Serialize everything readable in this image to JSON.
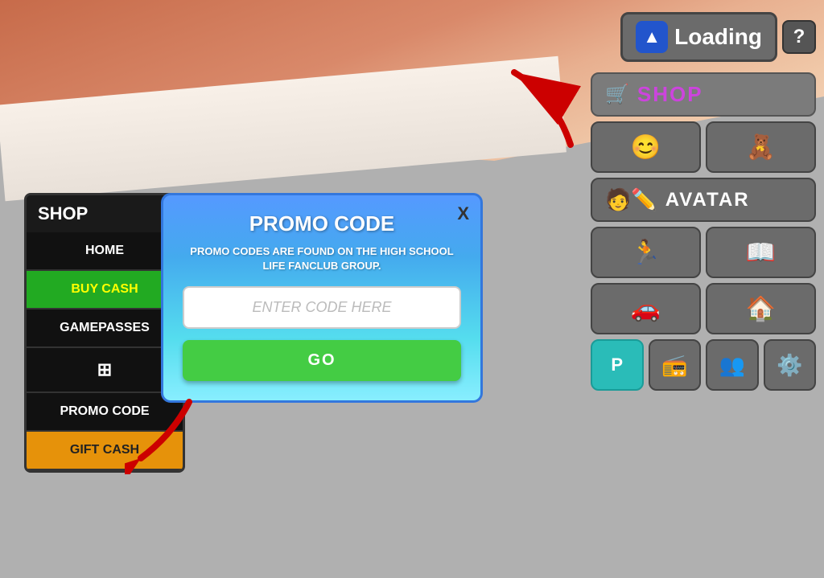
{
  "game": {
    "title": "High School Life"
  },
  "top_bar": {
    "loading_label": "Loading",
    "question_label": "?"
  },
  "right_sidebar": {
    "shop_label": "SHOP",
    "avatar_label": "AVATAR",
    "icons": {
      "smiley": "😊",
      "teddy": "🧸",
      "runner": "🏃",
      "book": "📖",
      "car": "🚗",
      "house": "🏠",
      "parking": "P",
      "radio": "📻",
      "people": "👥",
      "gear": "⚙️"
    }
  },
  "shop_menu": {
    "title": "SHOP",
    "items": [
      {
        "id": "home",
        "label": "HOME",
        "style": "dark"
      },
      {
        "id": "buy-cash",
        "label": "BUY CASH",
        "style": "green"
      },
      {
        "id": "gamepasses",
        "label": "GAMEPASSES",
        "style": "dark2"
      },
      {
        "id": "icon",
        "label": "⊞",
        "style": "icon-item"
      },
      {
        "id": "promo-code",
        "label": "PROMO CODE",
        "style": "promo"
      },
      {
        "id": "gift-cash",
        "label": "GIFT CASH",
        "style": "gift"
      }
    ]
  },
  "promo_modal": {
    "title": "PROMO CODE",
    "description": "PROMO CODES ARE FOUND ON THE HIGH SCHOOL LIFE FANCLUB GROUP.",
    "input_placeholder": "ENTER CODE HERE",
    "go_button": "GO",
    "close_button": "X"
  }
}
